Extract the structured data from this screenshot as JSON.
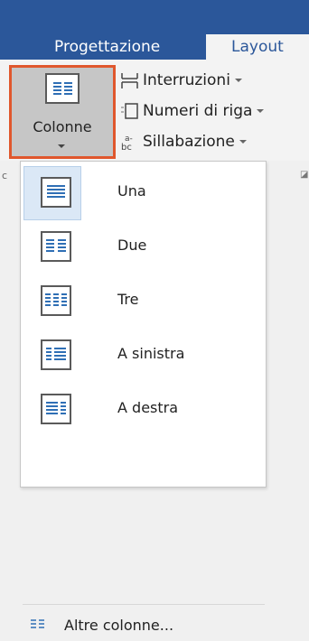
{
  "ribbon_tabs": [
    "Progettazione",
    "Layout"
  ],
  "colonne_button": {
    "label": "Colonne",
    "icon": "columns-icon"
  },
  "commands": {
    "interruzioni": {
      "label": "Interruzioni",
      "icon": "breaks-icon"
    },
    "numeri_riga": {
      "label": "Numeri di riga",
      "icon": "line-numbers-icon"
    },
    "sillabazione": {
      "label": "Sillabazione",
      "icon": "hyphenation-icon"
    }
  },
  "ribbon_edge": {
    "left_text": "c"
  },
  "menu": {
    "items": [
      {
        "label": "Una",
        "icon": "one-column-icon",
        "selected": true
      },
      {
        "label": "Due",
        "icon": "two-columns-icon"
      },
      {
        "label": "Tre",
        "icon": "three-columns-icon"
      },
      {
        "label": "A sinistra",
        "icon": "left-column-icon"
      },
      {
        "label": "A destra",
        "icon": "right-column-icon"
      }
    ],
    "more": {
      "label": "Altre colonne...",
      "icon": "more-columns-icon"
    }
  },
  "colors": {
    "ribbon_blue": "#2b579a",
    "highlight_border": "#e0572d",
    "accent_line": "#2f6fb5"
  }
}
